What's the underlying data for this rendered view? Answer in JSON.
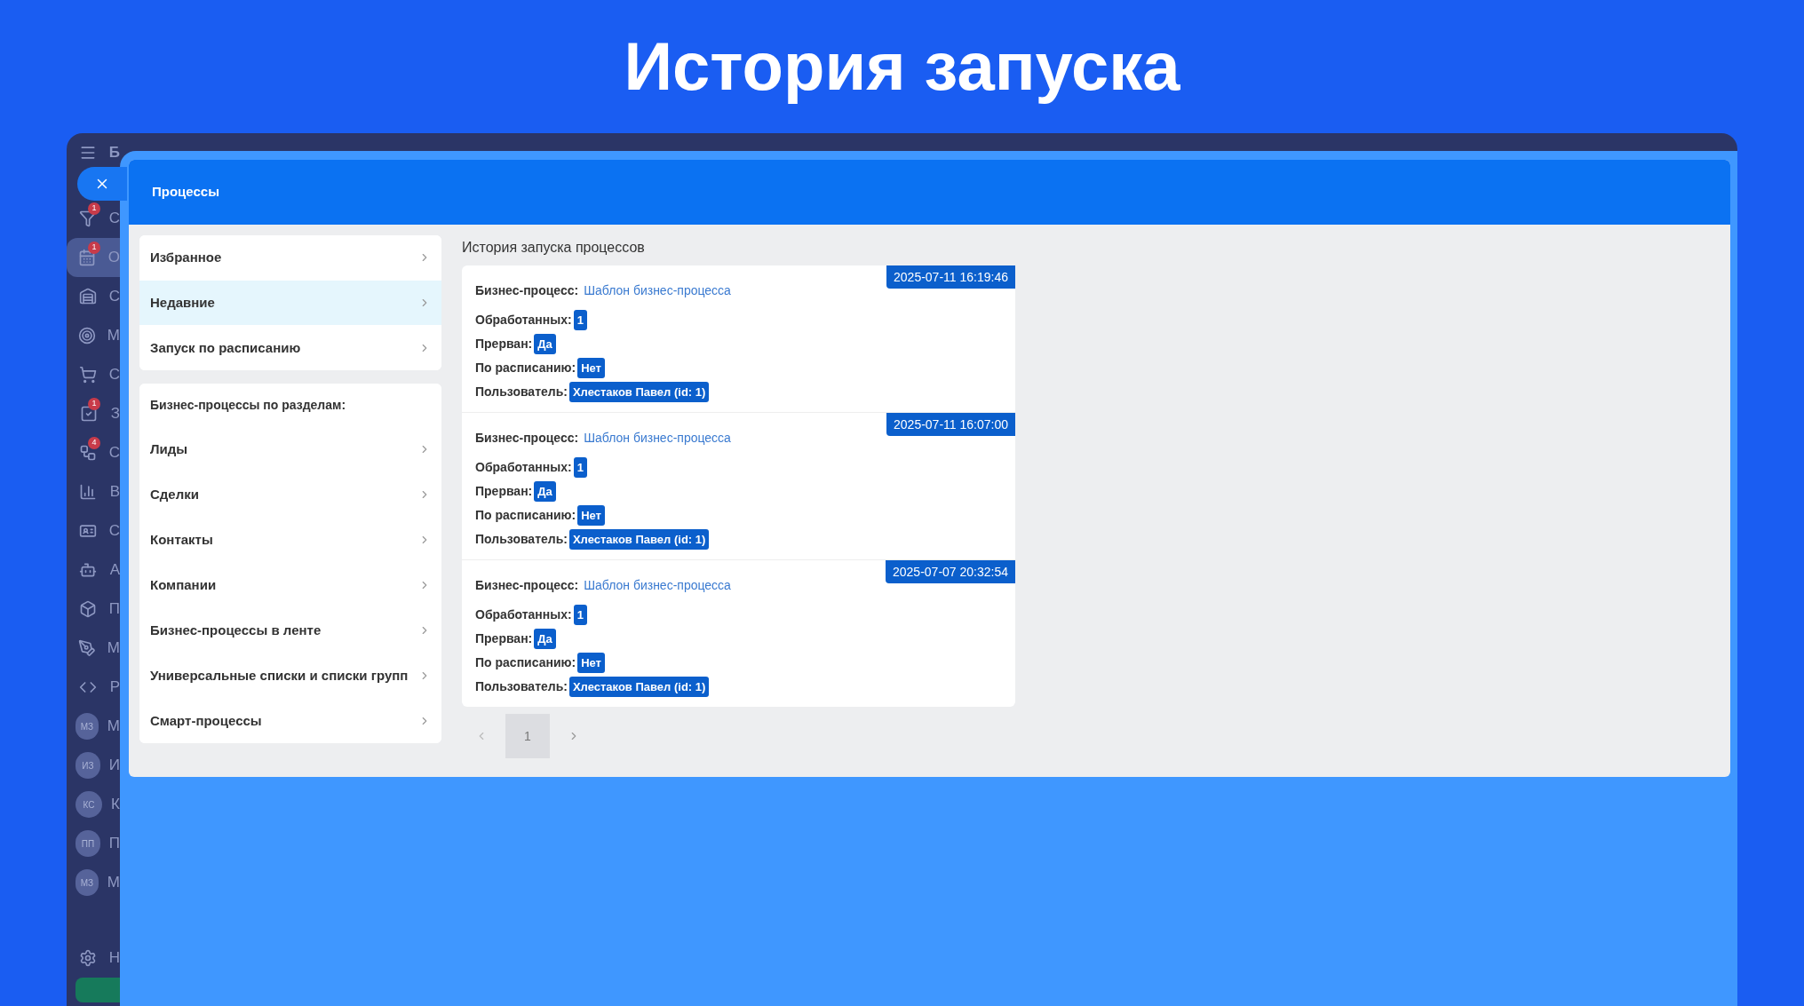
{
  "headline": "История запуска",
  "sidebar": {
    "items": [
      {
        "kind": "icon",
        "letter": "С",
        "badge": "1",
        "selected": false
      },
      {
        "kind": "icon",
        "letter": "О",
        "badge": "1",
        "selected": true
      },
      {
        "kind": "icon",
        "letter": "С",
        "selected": false
      },
      {
        "kind": "icon",
        "letter": "М",
        "selected": false
      },
      {
        "kind": "icon",
        "letter": "С",
        "selected": false
      },
      {
        "kind": "icon",
        "letter": "З",
        "badge": "1",
        "selected": false
      },
      {
        "kind": "icon",
        "letter": "С",
        "badge": "4",
        "selected": false
      },
      {
        "kind": "icon",
        "letter": "В",
        "selected": false
      },
      {
        "kind": "icon",
        "letter": "С",
        "selected": false
      },
      {
        "kind": "icon",
        "letter": "А",
        "selected": false
      },
      {
        "kind": "icon",
        "letter": "П",
        "selected": false
      },
      {
        "kind": "icon",
        "letter": "М",
        "selected": false
      },
      {
        "kind": "icon",
        "letter": "Р",
        "selected": false
      },
      {
        "kind": "avatar",
        "initials": "МЗ",
        "letter": "М",
        "selected": false
      },
      {
        "kind": "avatar",
        "initials": "ИЗ",
        "letter": "И",
        "selected": false
      },
      {
        "kind": "avatar",
        "initials": "КС",
        "letter": "К",
        "selected": false
      },
      {
        "kind": "avatar",
        "initials": "ПП",
        "letter": "П",
        "selected": false
      },
      {
        "kind": "avatar",
        "initials": "МЗ",
        "letter": "М",
        "selected": false
      }
    ],
    "settings_letter": "Н",
    "top_letter": "Б"
  },
  "panel": {
    "title": "Процессы"
  },
  "menu": {
    "groups": [
      {
        "items": [
          {
            "label": "Избранное",
            "selected": false
          },
          {
            "label": "Недавние",
            "selected": true
          },
          {
            "label": "Запуск по расписанию",
            "selected": false
          }
        ]
      },
      {
        "heading": "Бизнес-процессы по разделам:",
        "items": [
          {
            "label": "Лиды",
            "selected": false
          },
          {
            "label": "Сделки",
            "selected": false
          },
          {
            "label": "Контакты",
            "selected": false
          },
          {
            "label": "Компании",
            "selected": false
          },
          {
            "label": "Бизнес-процессы в ленте",
            "selected": false
          },
          {
            "label": "Универсальные списки и списки групп",
            "selected": false
          },
          {
            "label": "Смарт-процессы",
            "selected": false
          }
        ]
      }
    ]
  },
  "history": {
    "title": "История запуска процессов",
    "entries": [
      {
        "timestamp": "2025-07-11 16:19:46",
        "process_label": "Бизнес-процесс:",
        "process": "Шаблон бизнес-процесса",
        "fields": [
          {
            "label": "Обработанных:",
            "value": "1"
          },
          {
            "label": "Прерван:",
            "value": "Да"
          },
          {
            "label": "По расписанию:",
            "value": "Нет"
          },
          {
            "label": "Пользователь:",
            "value": "Хлестаков Павел (id: 1)"
          }
        ]
      },
      {
        "timestamp": "2025-07-11 16:07:00",
        "process_label": "Бизнес-процесс:",
        "process": "Шаблон бизнес-процесса",
        "fields": [
          {
            "label": "Обработанных:",
            "value": "1"
          },
          {
            "label": "Прерван:",
            "value": "Да"
          },
          {
            "label": "По расписанию:",
            "value": "Нет"
          },
          {
            "label": "Пользователь:",
            "value": "Хлестаков Павел (id: 1)"
          }
        ]
      },
      {
        "timestamp": "2025-07-07 20:32:54",
        "process_label": "Бизнес-процесс:",
        "process": "Шаблон бизнес-процесса",
        "fields": [
          {
            "label": "Обработанных:",
            "value": "1"
          },
          {
            "label": "Прерван:",
            "value": "Да"
          },
          {
            "label": "По расписанию:",
            "value": "Нет"
          },
          {
            "label": "Пользователь:",
            "value": "Хлестаков Павел (id: 1)"
          }
        ]
      }
    ]
  },
  "pagination": {
    "pages": [
      {
        "label": "1",
        "selected": true
      }
    ]
  }
}
